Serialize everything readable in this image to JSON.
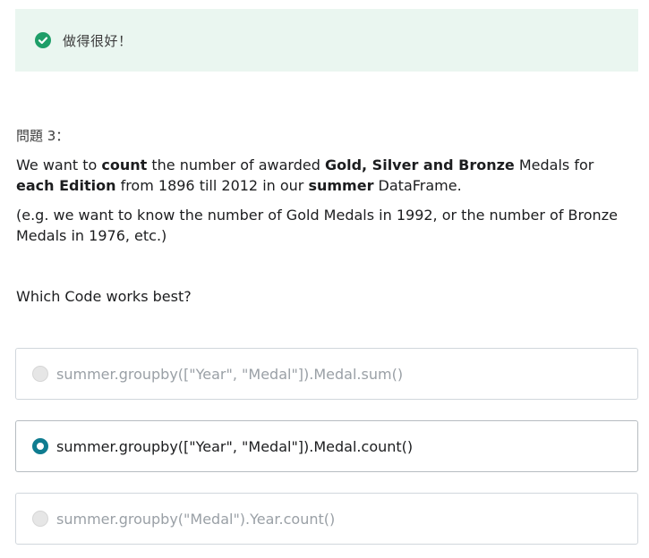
{
  "feedback": {
    "icon": "check-circle-icon",
    "color": "#1e9e68",
    "text": "做得很好！"
  },
  "question": {
    "label": "問題 3：",
    "line1_parts": [
      "We want to ",
      "count",
      " the number of awarded ",
      "Gold, Silver and Bronze",
      " Medals for ",
      "each Edition",
      " from 1896 till 2012 in our ",
      "summer",
      " DataFrame."
    ],
    "example": "(e.g. we want to know the number of Gold Medals in 1992, or the number of Bronze Medals in 1976, etc.)",
    "prompt": "Which Code works best?"
  },
  "options": [
    {
      "text": "summer.groupby([\"Year\", \"Medal\"]).Medal.sum()",
      "selected": false
    },
    {
      "text": "summer.groupby([\"Year\", \"Medal\"]).Medal.count()",
      "selected": true
    },
    {
      "text": "summer.groupby(\"Medal\").Year.count()",
      "selected": false
    }
  ],
  "colors": {
    "accent": "#0f7c90",
    "banner_bg": "#eaf6f0"
  }
}
